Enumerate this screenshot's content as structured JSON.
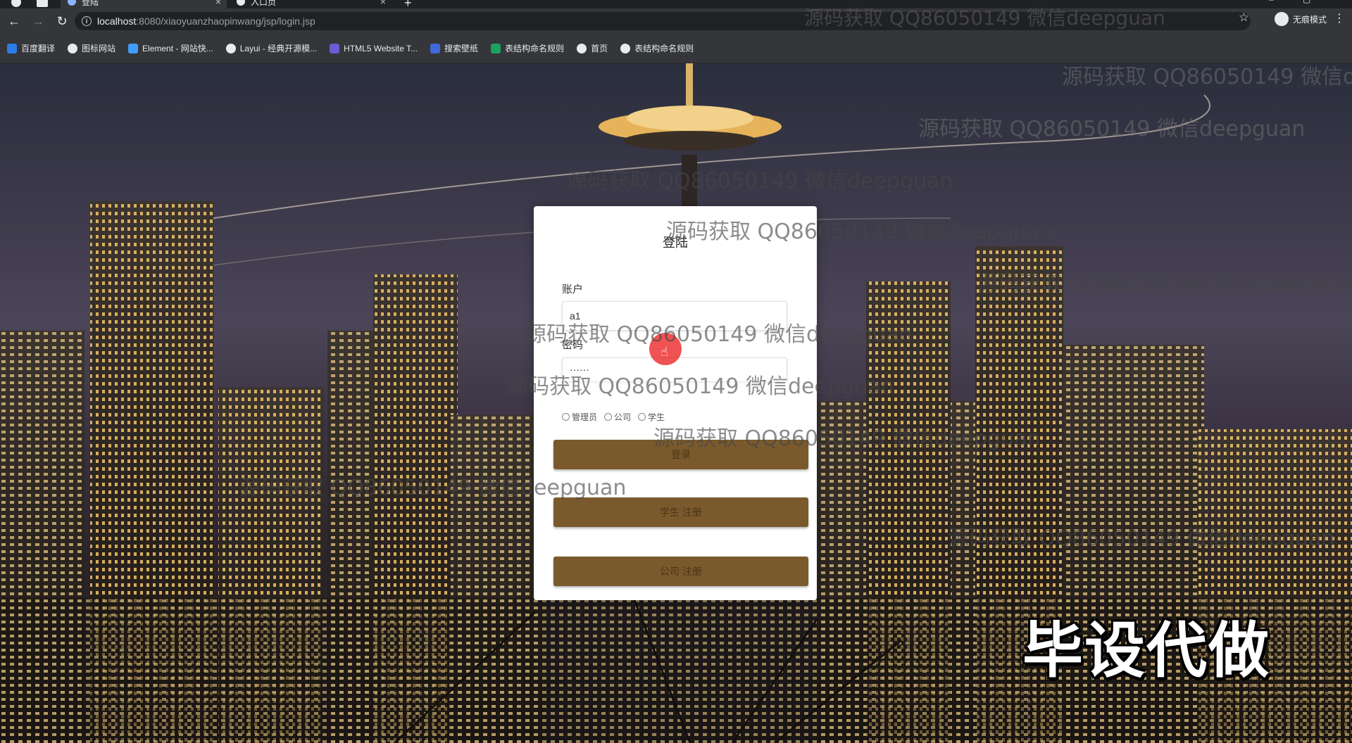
{
  "browser": {
    "tabs": [
      {
        "title": "登陆",
        "active": true
      },
      {
        "title": "入口页",
        "active": false
      }
    ],
    "url": {
      "host": "localhost",
      "path": ":8080/xiaoyuanzhaopinwang/jsp/login.jsp"
    },
    "incognito_label": "无痕模式",
    "bookmarks": [
      {
        "label": "百度翻译",
        "icon": "translate-icon",
        "color": "#2b7de9"
      },
      {
        "label": "图标网站",
        "icon": "flag-icon",
        "color": "#e8eaed"
      },
      {
        "label": "Element - 网站快...",
        "icon": "element-icon",
        "color": "#409eff"
      },
      {
        "label": "Layui - 经典开源模...",
        "icon": "layui-icon",
        "color": "#e8eaed"
      },
      {
        "label": "HTML5 Website T...",
        "icon": "html5-icon",
        "color": "#6b5bd6"
      },
      {
        "label": "搜索壁纸",
        "icon": "wallpaper-icon",
        "color": "#3f6ad8"
      },
      {
        "label": "表结构命名规则",
        "icon": "sheet-icon",
        "color": "#1aa260"
      },
      {
        "label": "首页",
        "icon": "globe-icon",
        "color": "#e8eaed"
      },
      {
        "label": "表结构命名规则",
        "icon": "globe-icon",
        "color": "#e8eaed"
      }
    ]
  },
  "login": {
    "title": "登陆",
    "account_label": "账户",
    "account_value": "a1",
    "password_label": "密码",
    "password_value": "······",
    "roles": [
      {
        "label": "管理员",
        "selected": false
      },
      {
        "label": "公司",
        "selected": false
      },
      {
        "label": "学生",
        "selected": false
      }
    ],
    "login_button": "登录",
    "student_register_button": "学生 注册",
    "company_register_button": "公司 注册",
    "button_color": "#7a5a2c"
  },
  "watermark": {
    "text": "源码获取 QQ86050149 微信deepguan",
    "stamp": "毕设代做"
  }
}
